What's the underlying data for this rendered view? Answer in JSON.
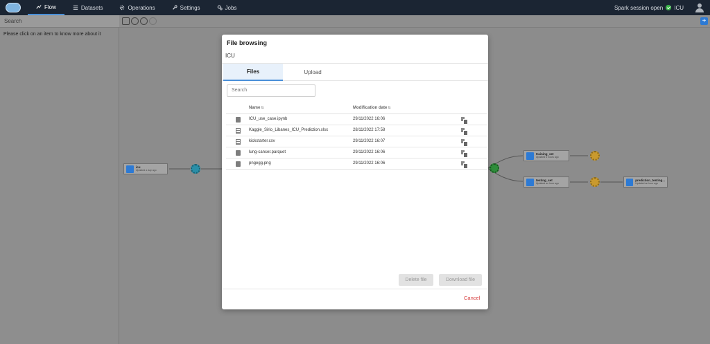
{
  "nav": {
    "tabs": [
      {
        "label": "Flow",
        "icon": "chart-line-icon"
      },
      {
        "label": "Datasets",
        "icon": "list-icon"
      },
      {
        "label": "Operations",
        "icon": "gear-icon"
      },
      {
        "label": "Settings",
        "icon": "wrench-icon"
      },
      {
        "label": "Jobs",
        "icon": "gears-icon"
      }
    ],
    "session_status": "Spark session open",
    "project": "ICU"
  },
  "left_panel": {
    "search_placeholder": "Search",
    "hint": "Please click on an item to know more about it"
  },
  "canvas": {
    "nodes": [
      {
        "title": "icu",
        "subtitle": "Updated a day ago"
      },
      {
        "title": "training_set",
        "subtitle": "Updated 6 hours ago"
      },
      {
        "title": "testing_set",
        "subtitle": "Updated an hour ago"
      },
      {
        "title": "prediction_testing...",
        "subtitle": "Updated an hour ago"
      }
    ]
  },
  "modal": {
    "title": "File browsing",
    "breadcrumb": "ICU",
    "tabs": {
      "files": "Files",
      "upload": "Upload"
    },
    "search_placeholder": "Search",
    "columns": {
      "name": "Name",
      "date": "Modification date"
    },
    "files": [
      {
        "name": "ICU_use_case.ipynb",
        "date": "29/11/2022 16:06",
        "icon": "document-icon"
      },
      {
        "name": "Kaggle_Sirio_Libanes_ICU_Prediction.xlsx",
        "date": "28/11/2022 17:58",
        "icon": "table-icon"
      },
      {
        "name": "kickstarter.csv",
        "date": "29/11/2022 16:07",
        "icon": "table-icon"
      },
      {
        "name": "lung-cancer.parquet",
        "date": "29/11/2022 16:06",
        "icon": "document-icon"
      },
      {
        "name": "pngegg.png",
        "date": "29/11/2022 16:06",
        "icon": "image-icon"
      }
    ],
    "buttons": {
      "delete": "Delete file",
      "download": "Download file",
      "cancel": "Cancel"
    }
  },
  "colors": {
    "accent": "#4a90d9",
    "danger": "#d63b3b",
    "nav_bg": "#1b2533"
  }
}
